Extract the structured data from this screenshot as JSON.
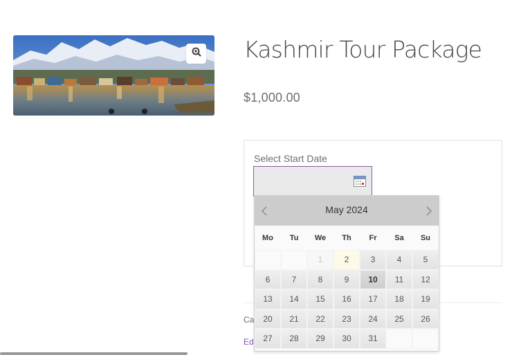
{
  "product": {
    "title": "Kashmir Tour Package",
    "price": "$1,000.00"
  },
  "booking": {
    "start_label": "Select Start Date",
    "start_value": ""
  },
  "meta": {
    "category_text": "Cat",
    "edit_text": "Edi"
  },
  "icons": {
    "zoom": "zoom-in-icon",
    "calendar": "calendar-icon",
    "prev": "chevron-left-icon",
    "next": "chevron-right-icon"
  },
  "datepicker": {
    "month_label": "May 2024",
    "weekdays": [
      "Mo",
      "Tu",
      "We",
      "Th",
      "Fr",
      "Sa",
      "Su"
    ],
    "weeks": [
      [
        {
          "d": "",
          "s": "empty"
        },
        {
          "d": "",
          "s": "empty"
        },
        {
          "d": "1",
          "s": "disabled"
        },
        {
          "d": "2",
          "s": "today"
        },
        {
          "d": "3",
          "s": ""
        },
        {
          "d": "4",
          "s": ""
        },
        {
          "d": "5",
          "s": ""
        }
      ],
      [
        {
          "d": "6",
          "s": ""
        },
        {
          "d": "7",
          "s": ""
        },
        {
          "d": "8",
          "s": ""
        },
        {
          "d": "9",
          "s": ""
        },
        {
          "d": "10",
          "s": "highlight"
        },
        {
          "d": "11",
          "s": ""
        },
        {
          "d": "12",
          "s": ""
        }
      ],
      [
        {
          "d": "13",
          "s": ""
        },
        {
          "d": "14",
          "s": ""
        },
        {
          "d": "15",
          "s": ""
        },
        {
          "d": "16",
          "s": ""
        },
        {
          "d": "17",
          "s": ""
        },
        {
          "d": "18",
          "s": ""
        },
        {
          "d": "19",
          "s": ""
        }
      ],
      [
        {
          "d": "20",
          "s": ""
        },
        {
          "d": "21",
          "s": ""
        },
        {
          "d": "22",
          "s": ""
        },
        {
          "d": "23",
          "s": ""
        },
        {
          "d": "24",
          "s": ""
        },
        {
          "d": "25",
          "s": ""
        },
        {
          "d": "26",
          "s": ""
        }
      ],
      [
        {
          "d": "27",
          "s": ""
        },
        {
          "d": "28",
          "s": ""
        },
        {
          "d": "29",
          "s": ""
        },
        {
          "d": "30",
          "s": ""
        },
        {
          "d": "31",
          "s": ""
        },
        {
          "d": "",
          "s": "empty"
        },
        {
          "d": "",
          "s": "empty"
        }
      ]
    ]
  },
  "colors": {
    "accent": "#7f54b3",
    "input_border": "#7c5ea2",
    "header_bg": "#cccccc"
  }
}
